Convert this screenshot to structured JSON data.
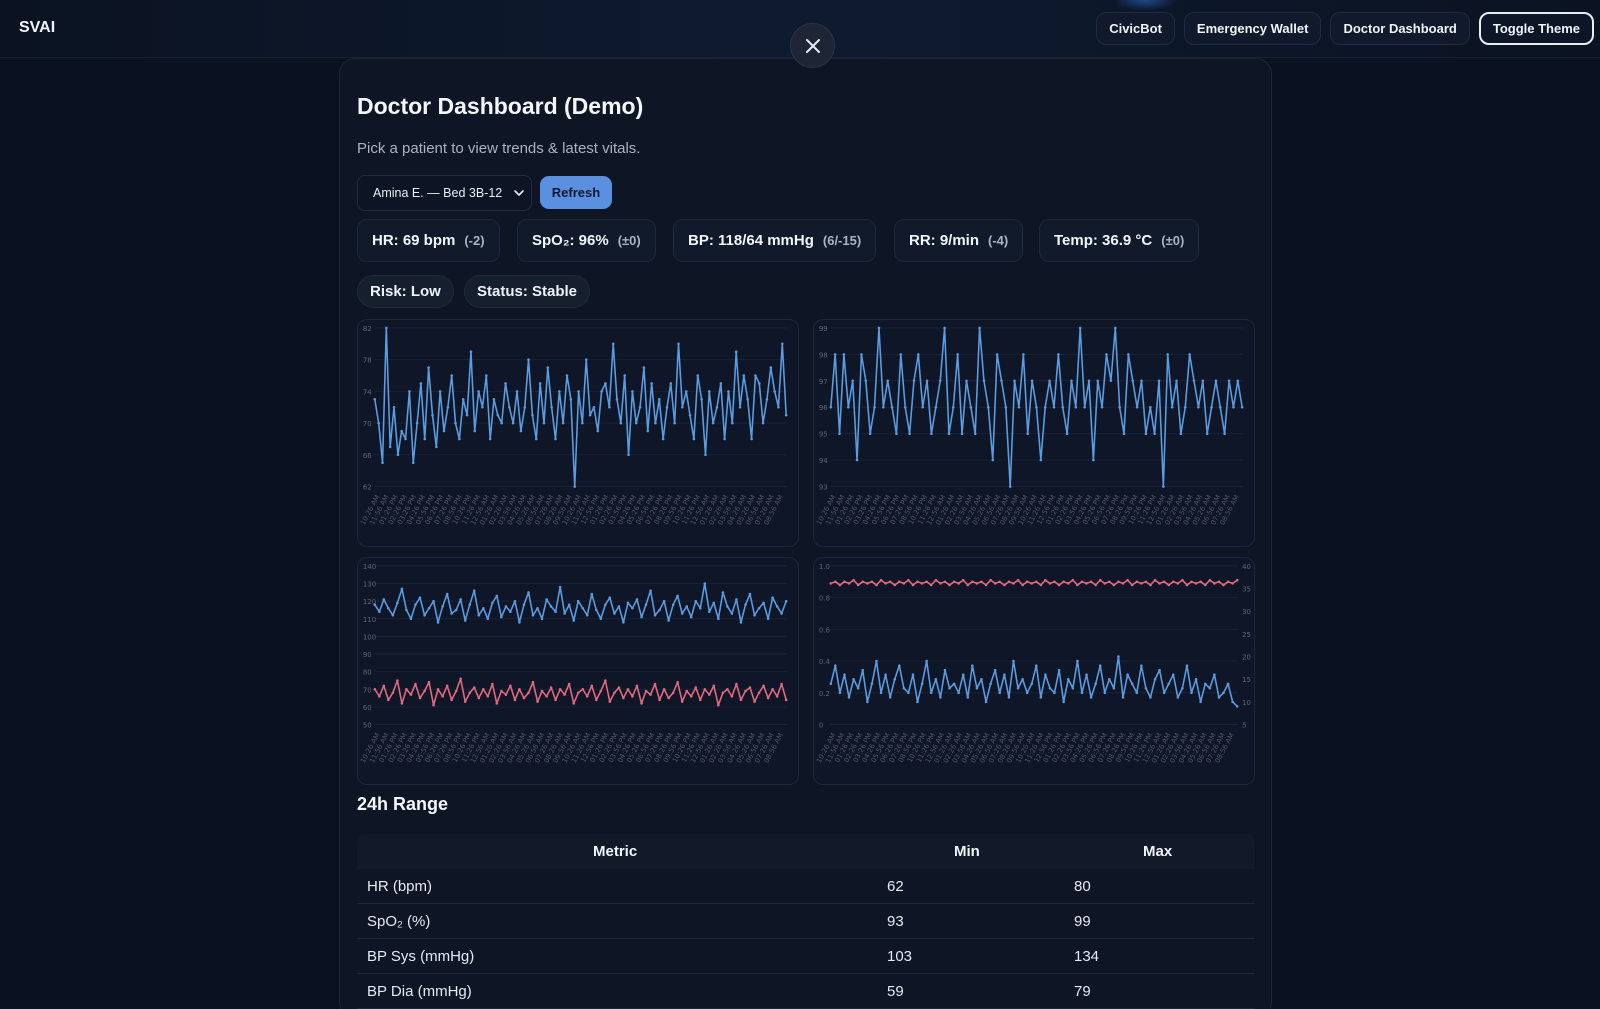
{
  "app": {
    "brand": "SVAI",
    "nav": [
      "CivicBot",
      "Emergency Wallet",
      "Doctor Dashboard",
      "Toggle Theme"
    ]
  },
  "modal": {
    "close_icon": "close-icon",
    "title": "Doctor Dashboard (Demo)",
    "subtitle": "Pick a patient to view trends & latest vitals.",
    "patient_select": {
      "selected": "Amina E. — Bed 3B-12"
    },
    "refresh_label": "Refresh",
    "vitals": [
      {
        "value": "HR: 69 bpm",
        "delta": "(-2)"
      },
      {
        "value": "SpO₂: 96%",
        "delta": "(±0)"
      },
      {
        "value": "BP: 118/64 mmHg",
        "delta": "(6/-15)"
      },
      {
        "value": "RR: 9/min",
        "delta": "(-4)"
      },
      {
        "value": "Temp: 36.9 °C",
        "delta": "(±0)"
      }
    ],
    "risk": "Risk: Low",
    "status": "Status: Stable",
    "range_title": "24h Range",
    "table": {
      "headers": [
        "Metric",
        "Min",
        "Max"
      ],
      "rows": [
        [
          "HR (bpm)",
          "62",
          "80"
        ],
        [
          "SpO₂ (%)",
          "93",
          "99"
        ],
        [
          "BP Sys (mmHg)",
          "103",
          "134"
        ],
        [
          "BP Dia (mmHg)",
          "59",
          "79"
        ]
      ]
    }
  },
  "colors": {
    "series_blue": "#5b9be0",
    "series_red": "#e06a7e",
    "accent": "#5b8fe0"
  },
  "chart_data": [
    {
      "type": "line",
      "series": [
        {
          "values": [
            73,
            70,
            65,
            82,
            67,
            72,
            66,
            69,
            68,
            74,
            65,
            70,
            75,
            68,
            77,
            71,
            67,
            74,
            69,
            72,
            76,
            70,
            68,
            73,
            71,
            79,
            69,
            74,
            72,
            76,
            68,
            73,
            71,
            70,
            75,
            72,
            70,
            74,
            69,
            72,
            78,
            71,
            68,
            75,
            70,
            77,
            72,
            68,
            74,
            70,
            76,
            73,
            62,
            74,
            70,
            78,
            71,
            72,
            69,
            74,
            75,
            72,
            80,
            73,
            70,
            76,
            66,
            74,
            70,
            72,
            77,
            69,
            75,
            70,
            73,
            68,
            72,
            75,
            70,
            80,
            72,
            74,
            71,
            68,
            76,
            73,
            66,
            74,
            70,
            72,
            75,
            68,
            74,
            70,
            79,
            72,
            76,
            73,
            68,
            76,
            75,
            70,
            73,
            77,
            74,
            72,
            80,
            71
          ]
        }
      ],
      "ylim": [
        62,
        82
      ],
      "yticks": [
        "62",
        "66",
        "70",
        "74",
        "78",
        "82"
      ],
      "xticks": [
        "10:26 AM",
        "11:56 AM",
        "01:26 PM",
        "02:26 PM",
        "03:26 PM",
        "04:26 PM",
        "05:56 PM",
        "06:26 PM",
        "07:26 PM",
        "08:56 PM",
        "10:26 PM",
        "11:26 PM",
        "12:56 AM",
        "01:26 AM",
        "02:26 AM",
        "03:56 AM",
        "04:26 AM",
        "05:26 AM",
        "06:56 AM",
        "07:26 AM",
        "08:26 AM",
        "09:56 AM",
        "10:26 AM",
        "11:26 AM",
        "12:56 PM",
        "01:26 PM",
        "02:26 PM",
        "03:56 PM",
        "04:26 PM",
        "05:26 PM",
        "06:56 PM",
        "07:26 PM",
        "08:26 PM",
        "09:56 PM",
        "10:26 PM",
        "11:26 PM",
        "12:56 AM",
        "01:26 AM",
        "02:26 AM",
        "03:56 AM",
        "04:26 AM",
        "05:26 AM",
        "06:56 AM",
        "07:26 AM",
        "08:56 AM"
      ]
    },
    {
      "type": "line",
      "series": [
        {
          "values": [
            96,
            98,
            95,
            98,
            96,
            97,
            94,
            98,
            97,
            95,
            96,
            99,
            96,
            97,
            96,
            95,
            98,
            96,
            95,
            97,
            98,
            96,
            97,
            95,
            96,
            97,
            99,
            95,
            96,
            98,
            95,
            97,
            96,
            95,
            99,
            97,
            96,
            94,
            98,
            97,
            96,
            93,
            97,
            96,
            98,
            95,
            97,
            96,
            94,
            96,
            97,
            96,
            98,
            96,
            95,
            97,
            96,
            99,
            96,
            97,
            94,
            97,
            96,
            98,
            97,
            99,
            96,
            95,
            98,
            97,
            96,
            97,
            95,
            96,
            95,
            97,
            93,
            98,
            96,
            97,
            95,
            96,
            98,
            97,
            96,
            97,
            95,
            96,
            97,
            96,
            95,
            97,
            96,
            97,
            96
          ]
        }
      ],
      "ylim": [
        93,
        99
      ],
      "yticks": [
        "93",
        "94",
        "95",
        "96",
        "97",
        "98",
        "99"
      ],
      "xticks": [
        "10:26 AM",
        "11:56 AM",
        "01:26 PM",
        "02:26 PM",
        "03:26 PM",
        "04:26 PM",
        "05:56 PM",
        "06:26 PM",
        "07:26 PM",
        "08:56 PM",
        "10:26 PM",
        "11:26 PM",
        "12:56 AM",
        "01:26 AM",
        "02:26 AM",
        "03:56 AM",
        "04:26 AM",
        "05:26 AM",
        "06:56 AM",
        "07:26 AM",
        "08:26 AM",
        "09:56 AM",
        "10:26 AM",
        "11:26 AM",
        "12:56 PM",
        "01:26 PM",
        "02:26 PM",
        "03:56 PM",
        "04:26 PM",
        "05:26 PM",
        "06:56 PM",
        "07:26 PM",
        "08:26 PM",
        "09:56 PM",
        "10:26 PM",
        "11:26 PM",
        "12:56 AM",
        "01:26 AM",
        "02:26 AM",
        "03:56 AM",
        "04:26 AM",
        "05:26 AM",
        "06:56 AM",
        "07:26 AM",
        "08:56 AM"
      ]
    },
    {
      "type": "line",
      "series": [
        {
          "values": [
            118,
            114,
            121,
            116,
            112,
            119,
            127,
            115,
            110,
            118,
            122,
            112,
            116,
            120,
            108,
            117,
            124,
            113,
            115,
            121,
            109,
            118,
            126,
            112,
            116,
            110,
            119,
            123,
            111,
            117,
            114,
            120,
            108,
            118,
            125,
            112,
            116,
            110,
            121,
            117,
            114,
            128,
            113,
            118,
            109,
            120,
            116,
            112,
            124,
            115,
            110,
            118,
            122,
            113,
            117,
            108,
            119,
            116,
            121,
            111,
            118,
            126,
            112,
            115,
            120,
            109,
            118,
            123,
            113,
            117,
            111,
            120,
            116,
            130,
            114,
            119,
            110,
            125,
            117,
            113,
            121,
            108,
            118,
            124,
            112,
            116,
            119,
            110,
            122,
            117,
            113,
            120
          ]
        },
        {
          "values": [
            70,
            66,
            72,
            64,
            68,
            75,
            62,
            70,
            67,
            73,
            65,
            69,
            74,
            61,
            70,
            66,
            72,
            64,
            69,
            76,
            63,
            68,
            71,
            65,
            70,
            66,
            73,
            62,
            69,
            67,
            72,
            64,
            70,
            65,
            68,
            74,
            63,
            69,
            66,
            71,
            64,
            70,
            67,
            73,
            62,
            68,
            70,
            66,
            72,
            64,
            69,
            75,
            63,
            68,
            71,
            65,
            70,
            66,
            72,
            62,
            69,
            67,
            73,
            64,
            70,
            65,
            68,
            74,
            63,
            69,
            66,
            71,
            64,
            70,
            67,
            72,
            61,
            68,
            70,
            66,
            73,
            64,
            69,
            71,
            63,
            68,
            72,
            65,
            70,
            66,
            73,
            64
          ]
        }
      ],
      "ylim": [
        50,
        140
      ],
      "yticks": [
        "50",
        "60",
        "70",
        "80",
        "90",
        "100",
        "110",
        "120",
        "130",
        "140"
      ],
      "xticks": [
        "10:26 AM",
        "11:56 AM",
        "01:26 PM",
        "02:26 PM",
        "03:26 PM",
        "04:26 PM",
        "05:56 PM",
        "06:26 PM",
        "07:26 PM",
        "08:56 PM",
        "10:26 PM",
        "11:26 PM",
        "12:56 AM",
        "01:26 AM",
        "02:26 AM",
        "03:56 AM",
        "04:26 AM",
        "05:26 AM",
        "06:56 AM",
        "07:26 AM",
        "08:26 AM",
        "09:56 AM",
        "10:26 AM",
        "11:26 AM",
        "12:56 PM",
        "01:26 PM",
        "02:26 PM",
        "03:56 PM",
        "04:26 PM",
        "05:26 PM",
        "06:56 PM",
        "07:26 PM",
        "08:26 PM",
        "09:56 PM",
        "10:26 PM",
        "11:26 PM",
        "12:56 AM",
        "01:26 AM",
        "02:26 AM",
        "03:56 AM",
        "04:26 AM",
        "05:26 AM",
        "06:56 AM",
        "07:26 AM",
        "08:56 AM"
      ]
    },
    {
      "type": "line",
      "series": [
        {
          "axis": "left",
          "values": [
            0.89,
            0.9,
            0.88,
            0.9,
            0.89,
            0.91,
            0.88,
            0.9,
            0.89,
            0.9,
            0.88,
            0.91,
            0.89,
            0.9,
            0.88,
            0.9,
            0.89,
            0.91,
            0.88,
            0.9,
            0.89,
            0.9,
            0.88,
            0.91,
            0.89,
            0.9,
            0.88,
            0.9,
            0.89,
            0.91,
            0.88,
            0.9,
            0.89,
            0.9,
            0.88,
            0.91,
            0.89,
            0.9,
            0.88,
            0.9,
            0.89,
            0.91,
            0.88,
            0.9,
            0.89,
            0.9,
            0.88,
            0.91,
            0.89,
            0.9,
            0.88,
            0.9,
            0.89,
            0.91,
            0.88,
            0.9,
            0.89,
            0.9,
            0.88,
            0.91,
            0.89,
            0.9,
            0.88,
            0.9,
            0.89,
            0.91,
            0.88,
            0.9,
            0.89,
            0.9,
            0.88,
            0.91,
            0.89,
            0.9,
            0.88,
            0.9,
            0.89,
            0.91,
            0.88,
            0.9,
            0.89,
            0.9,
            0.88,
            0.91,
            0.89,
            0.9,
            0.88,
            0.9,
            0.89,
            0.91
          ]
        },
        {
          "axis": "right",
          "values": [
            14,
            18,
            12,
            16,
            11,
            15,
            13,
            17,
            10,
            14,
            19,
            12,
            16,
            11,
            15,
            18,
            13,
            12,
            16,
            10,
            14,
            19,
            12,
            15,
            11,
            17,
            13,
            14,
            12,
            16,
            11,
            18,
            13,
            15,
            10,
            14,
            17,
            12,
            16,
            11,
            19,
            13,
            15,
            12,
            14,
            18,
            11,
            16,
            13,
            12,
            17,
            10,
            15,
            13,
            19,
            12,
            16,
            11,
            14,
            18,
            12,
            15,
            13,
            20,
            11,
            16,
            14,
            12,
            18,
            13,
            11,
            15,
            17,
            12,
            14,
            16,
            11,
            13,
            18,
            12,
            15,
            10,
            14,
            13,
            16,
            11,
            12,
            14,
            10,
            9
          ]
        }
      ],
      "ylim": [
        0,
        1.0
      ],
      "y2lim": [
        5,
        40
      ],
      "yticks": [
        "0",
        "0.2",
        "0.4",
        "0.6",
        "0.8",
        "1.0"
      ],
      "y2ticks": [
        "5",
        "10",
        "15",
        "20",
        "25",
        "30",
        "35",
        "40"
      ],
      "xticks": [
        "10:26 AM",
        "11:56 AM",
        "01:26 PM",
        "02:26 PM",
        "03:26 PM",
        "04:26 PM",
        "05:56 PM",
        "06:26 PM",
        "07:26 PM",
        "08:56 PM",
        "10:26 PM",
        "11:26 PM",
        "12:56 AM",
        "01:26 AM",
        "02:26 AM",
        "03:56 AM",
        "04:26 AM",
        "05:26 AM",
        "06:56 AM",
        "07:26 AM",
        "08:26 AM",
        "09:56 AM",
        "10:26 AM",
        "11:26 AM",
        "12:56 PM",
        "01:26 PM",
        "02:26 PM",
        "03:56 PM",
        "04:26 PM",
        "05:26 PM",
        "06:56 PM",
        "07:26 PM",
        "08:26 PM",
        "09:56 PM",
        "10:26 PM",
        "11:26 PM",
        "12:56 AM",
        "01:26 AM",
        "02:26 AM",
        "03:56 AM",
        "04:26 AM",
        "05:26 AM",
        "06:56 AM",
        "07:26 AM",
        "08:56 AM"
      ]
    }
  ]
}
